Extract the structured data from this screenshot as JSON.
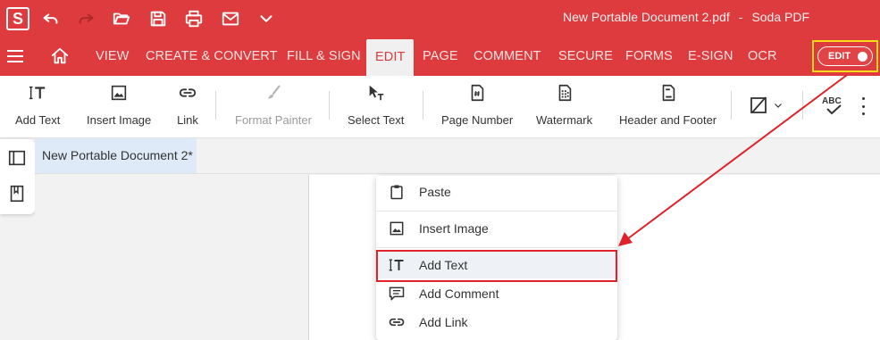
{
  "app": {
    "logo_letter": "S",
    "document_name": "New Portable Document 2.pdf",
    "separator": "-",
    "app_name": "Soda PDF"
  },
  "quick_access": [
    {
      "icon": "undo-icon"
    },
    {
      "icon": "redo-icon"
    },
    {
      "icon": "open-folder-icon"
    },
    {
      "icon": "save-icon"
    },
    {
      "icon": "print-icon"
    },
    {
      "icon": "email-icon"
    },
    {
      "icon": "chevron-down-icon"
    }
  ],
  "menu": {
    "items": [
      "VIEW",
      "CREATE & CONVERT",
      "FILL & SIGN",
      "EDIT",
      "PAGE",
      "COMMENT",
      "SECURE",
      "FORMS",
      "E-SIGN",
      "OCR"
    ],
    "active": "EDIT",
    "edit_toggle_label": "EDIT"
  },
  "ribbon": {
    "add_text": "Add Text",
    "insert_image": "Insert Image",
    "link": "Link",
    "format_painter": "Format Painter",
    "select_text": "Select Text",
    "page_number": "Page Number",
    "watermark": "Watermark",
    "header_footer": "Header and Footer",
    "spellcheck_glyph": "ABC"
  },
  "document_tab": {
    "title": "New Portable Document 2*"
  },
  "context_menu": {
    "items": [
      {
        "label": "Paste",
        "icon": "clipboard-icon"
      },
      {
        "label": "Insert Image",
        "icon": "image-icon"
      },
      {
        "label": "Add Text",
        "icon": "add-text-icon",
        "highlighted": true
      },
      {
        "label": "Add Comment",
        "icon": "comment-icon"
      },
      {
        "label": "Add Link",
        "icon": "link-icon"
      }
    ]
  },
  "colors": {
    "brand_red": "#dd3b3e",
    "highlight_yellow": "#f5dd1a",
    "annotation_red": "#e0222a",
    "tab_blue": "#dfeaf8"
  }
}
